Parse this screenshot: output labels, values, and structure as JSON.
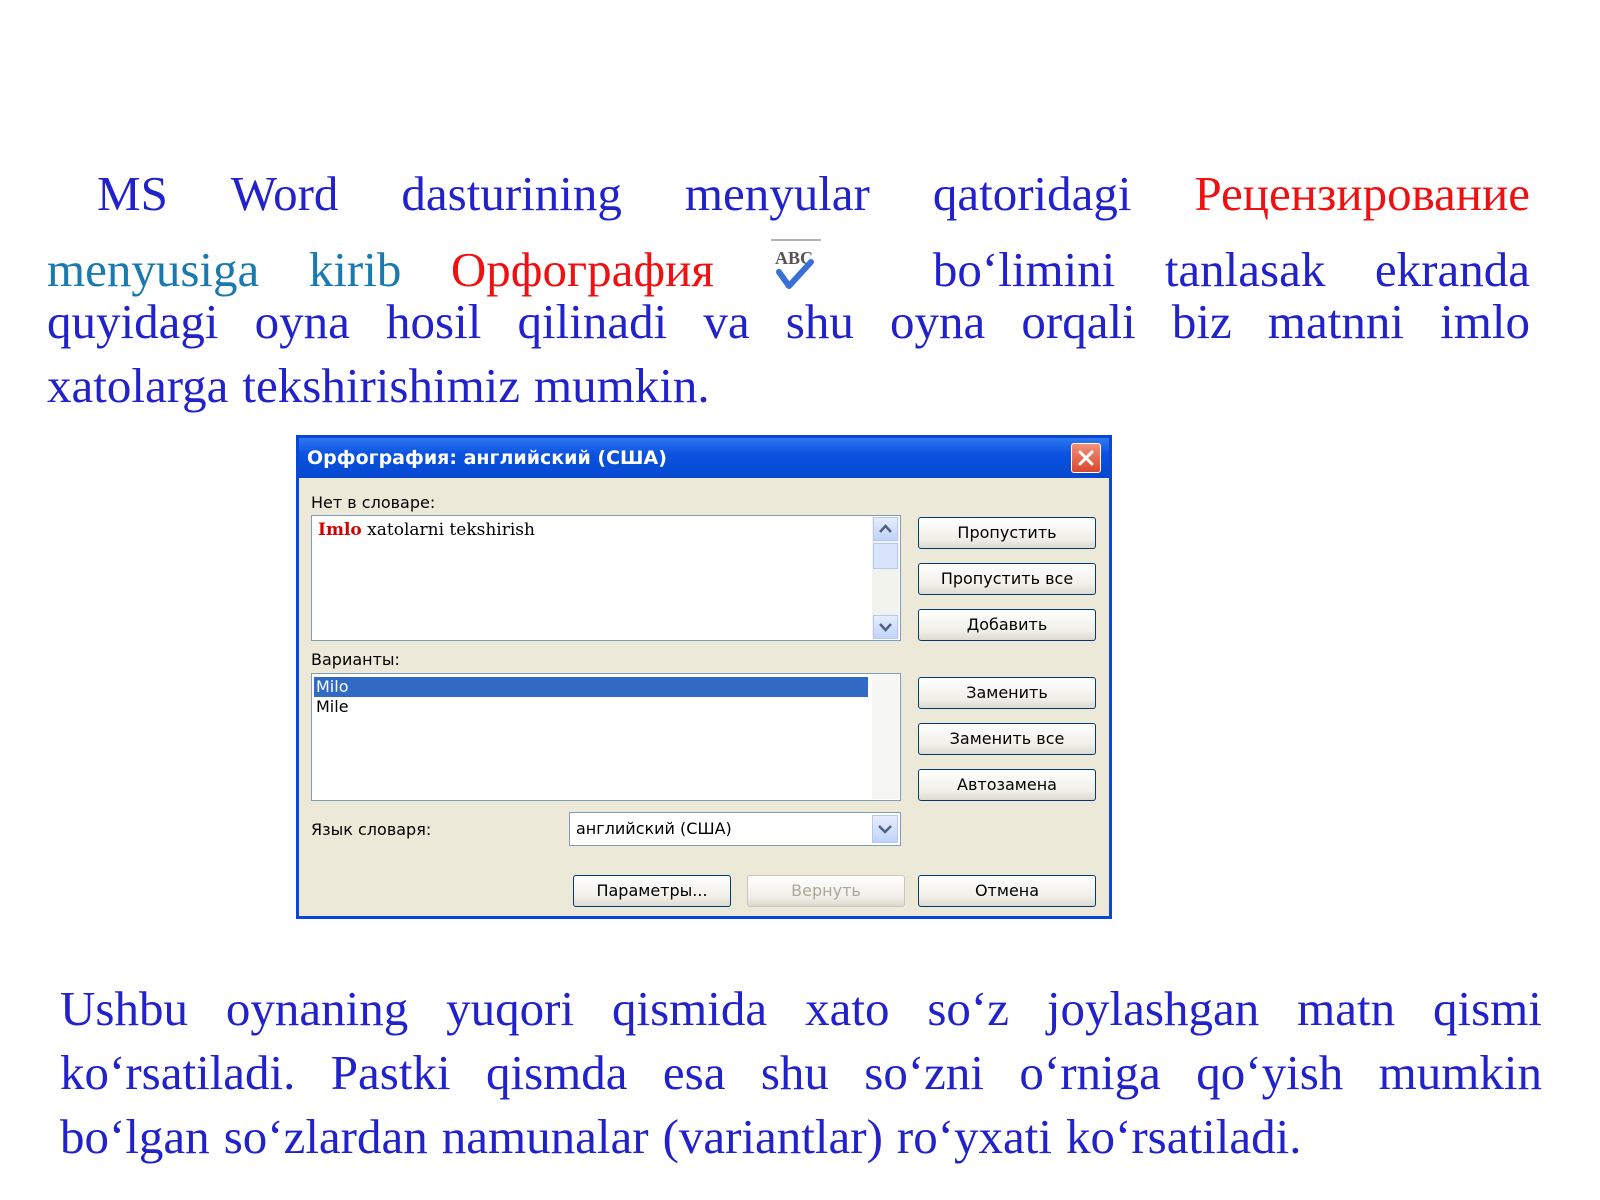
{
  "paragraph1": {
    "lines": [
      [
        "MS",
        "Word",
        "dasturining",
        "menyular",
        "qatoridagi",
        "Рецензирование"
      ],
      [
        "menyusiga",
        "kirib",
        "Орфография",
        "bo‘limini",
        "tanlasak",
        "ekranda"
      ],
      [
        "quyidagi",
        "oyna",
        "hosil",
        "qilinadi",
        "va",
        "shu",
        "oyna",
        "orqali",
        "biz",
        "matnni",
        "imlo"
      ],
      [
        "xatolarga",
        "tekshirishimiz",
        "mumkin."
      ]
    ],
    "icon": "abc-spellcheck-icon"
  },
  "dialog": {
    "title": "Орфография: английский (США)",
    "not_in_dict_label": "Нет в словаре:",
    "not_in_dict_error": "Imlo",
    "not_in_dict_rest": " xatolarni tekshirish",
    "variants_label": "Варианты:",
    "variants": [
      "Milo",
      "Mile"
    ],
    "selected_variant": "Milo",
    "lang_label": "Язык словаря:",
    "lang_value": "английский (США)",
    "buttons": {
      "skip": "Пропустить",
      "skip_all": "Пропустить все",
      "add": "Добавить",
      "replace": "Заменить",
      "replace_all": "Заменить все",
      "autocorrect": "Автозамена",
      "params": "Параметры...",
      "undo": "Вернуть",
      "cancel": "Отмена"
    },
    "colors": {
      "titlebar": "#0a52e0",
      "selection": "#316ac5",
      "error": "#d00000"
    }
  },
  "paragraph2": {
    "lines": [
      [
        "Ushbu",
        "oynaning",
        "yuqori",
        "qismida",
        "xato",
        "so‘z",
        "joylashgan",
        "matn",
        "qismi"
      ],
      [
        "ko‘rsatiladi.",
        "Pastki",
        "qismda",
        "esa",
        "shu",
        "so‘zni",
        "o‘rniga",
        "qo‘yish",
        "mumkin"
      ],
      [
        "bo‘lgan",
        "so‘zlardan",
        "namunalar",
        "(variantlar)",
        "ro‘yxati",
        "ko‘rsatiladi."
      ]
    ]
  },
  "text_colors": {
    "body": "#2222cc",
    "highlight": "#ee1111",
    "accent": "#1a7ab0"
  }
}
